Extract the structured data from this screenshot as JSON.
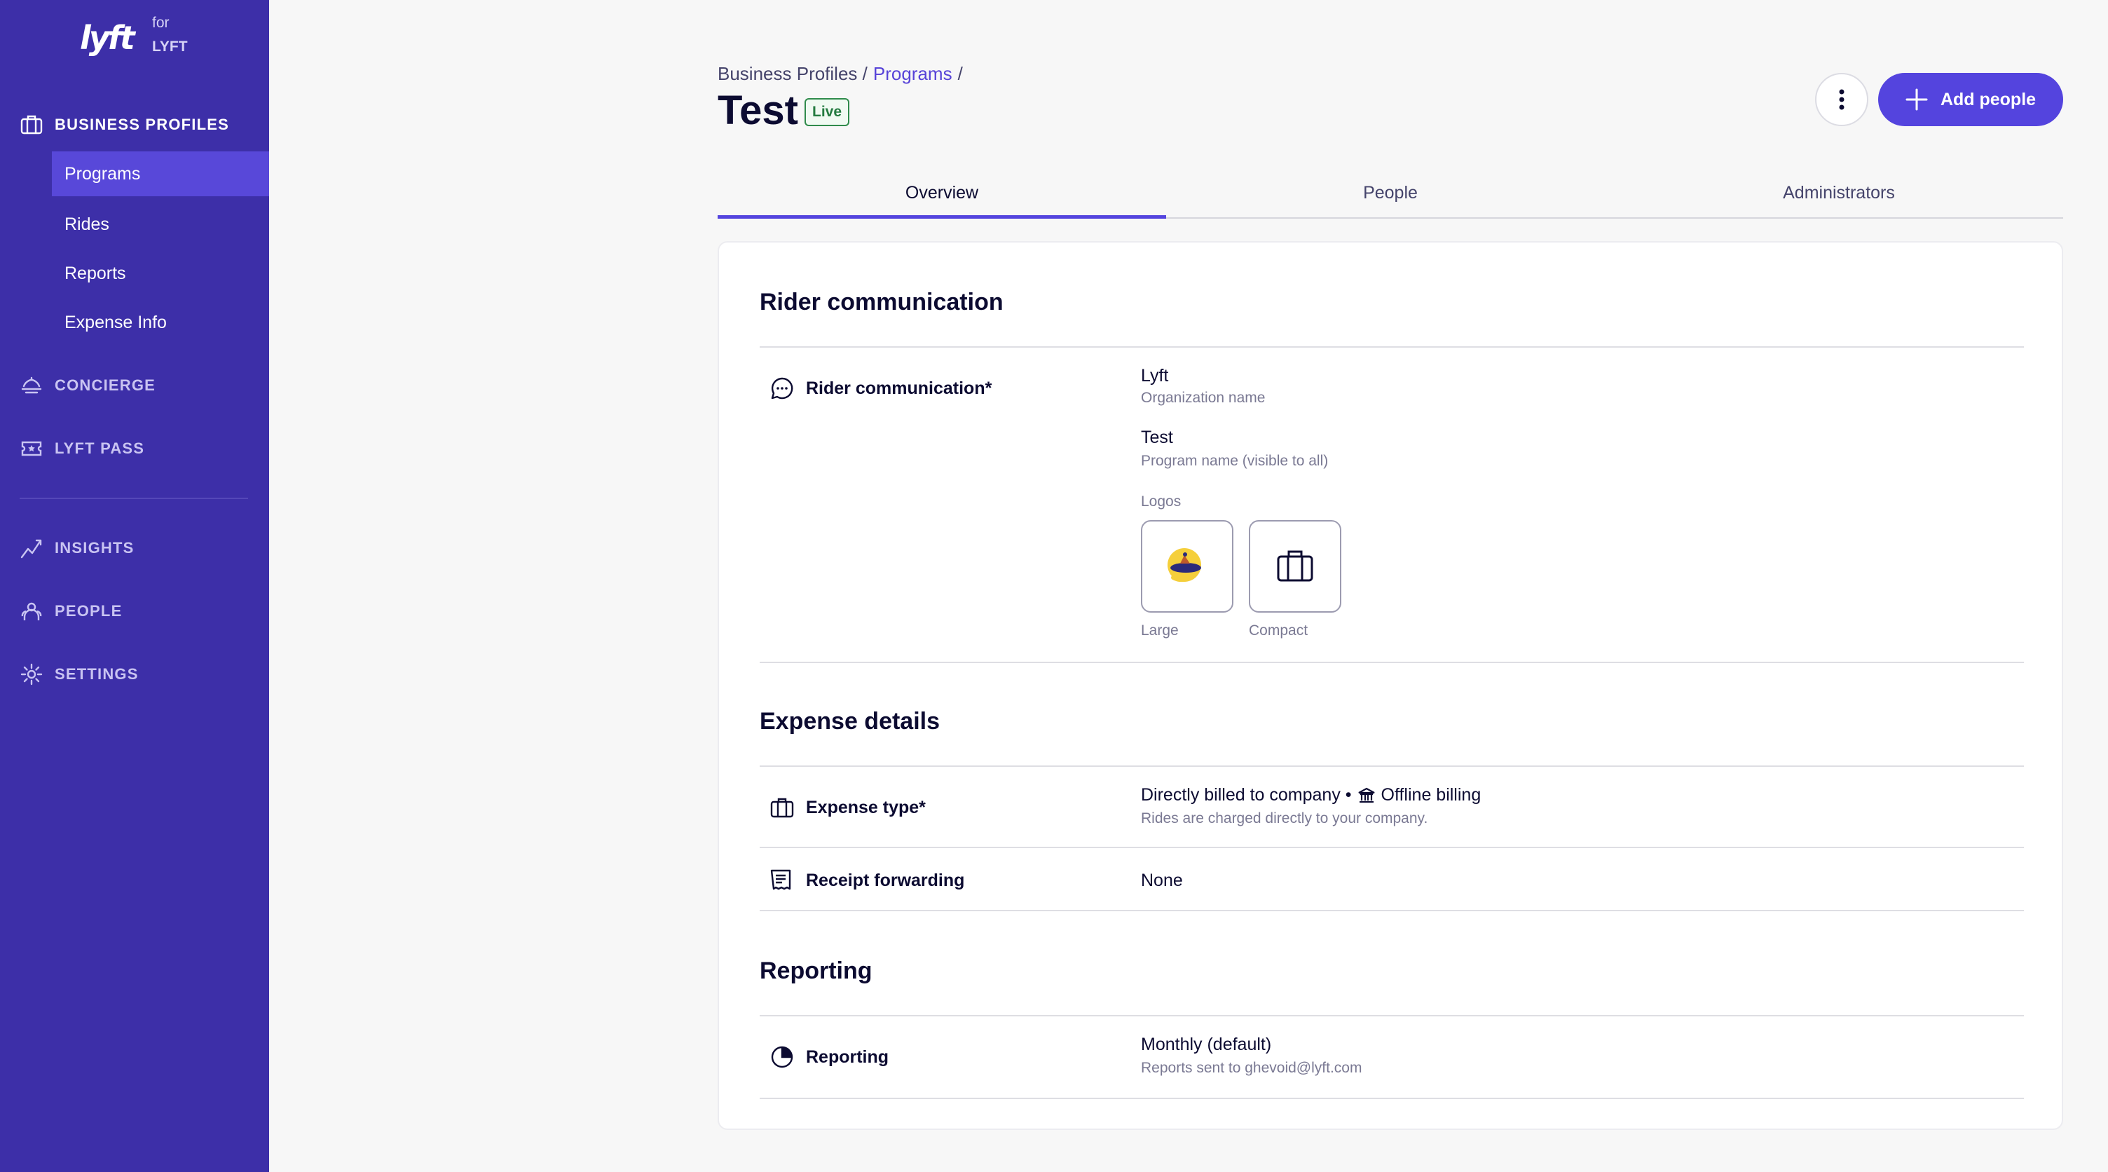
{
  "sidebar": {
    "logo_text": "lyft",
    "logo_for": "for",
    "logo_org": "LYFT",
    "business_profiles": "BUSINESS PROFILES",
    "items": [
      {
        "label": "Programs"
      },
      {
        "label": "Rides"
      },
      {
        "label": "Reports"
      },
      {
        "label": "Expense Info"
      }
    ],
    "concierge": "CONCIERGE",
    "lyft_pass": "LYFT PASS",
    "insights": "INSIGHTS",
    "people": "PEOPLE",
    "settings": "SETTINGS"
  },
  "header": {
    "breadcrumb_root": "Business Profiles /",
    "breadcrumb_link": "Programs",
    "breadcrumb_sep": "/",
    "title": "Test",
    "badge": "Live",
    "add_people": "Add people"
  },
  "tabs": [
    {
      "label": "Overview"
    },
    {
      "label": "People"
    },
    {
      "label": "Administrators"
    }
  ],
  "rider": {
    "section_title": "Rider communication",
    "label": "Rider communication*",
    "org_name": "Lyft",
    "org_name_caption": "Organization name",
    "program_name": "Test",
    "program_name_caption": "Program name (visible to all)",
    "logos_caption": "Logos",
    "logo_large": "Large",
    "logo_compact": "Compact"
  },
  "expense": {
    "section_title": "Expense details",
    "type_label": "Expense type*",
    "type_value": "Directly billed to company •",
    "type_billing": "Offline billing",
    "type_caption": "Rides are charged directly to your company.",
    "receipt_label": "Receipt forwarding",
    "receipt_value": "None"
  },
  "reporting": {
    "section_title": "Reporting",
    "label": "Reporting",
    "value": "Monthly (default)",
    "caption": "Reports sent to ghevoid@lyft.com"
  },
  "colors": {
    "sidebar": "#3d2fa8",
    "accent": "#5444de",
    "live": "#2f8b4b"
  }
}
